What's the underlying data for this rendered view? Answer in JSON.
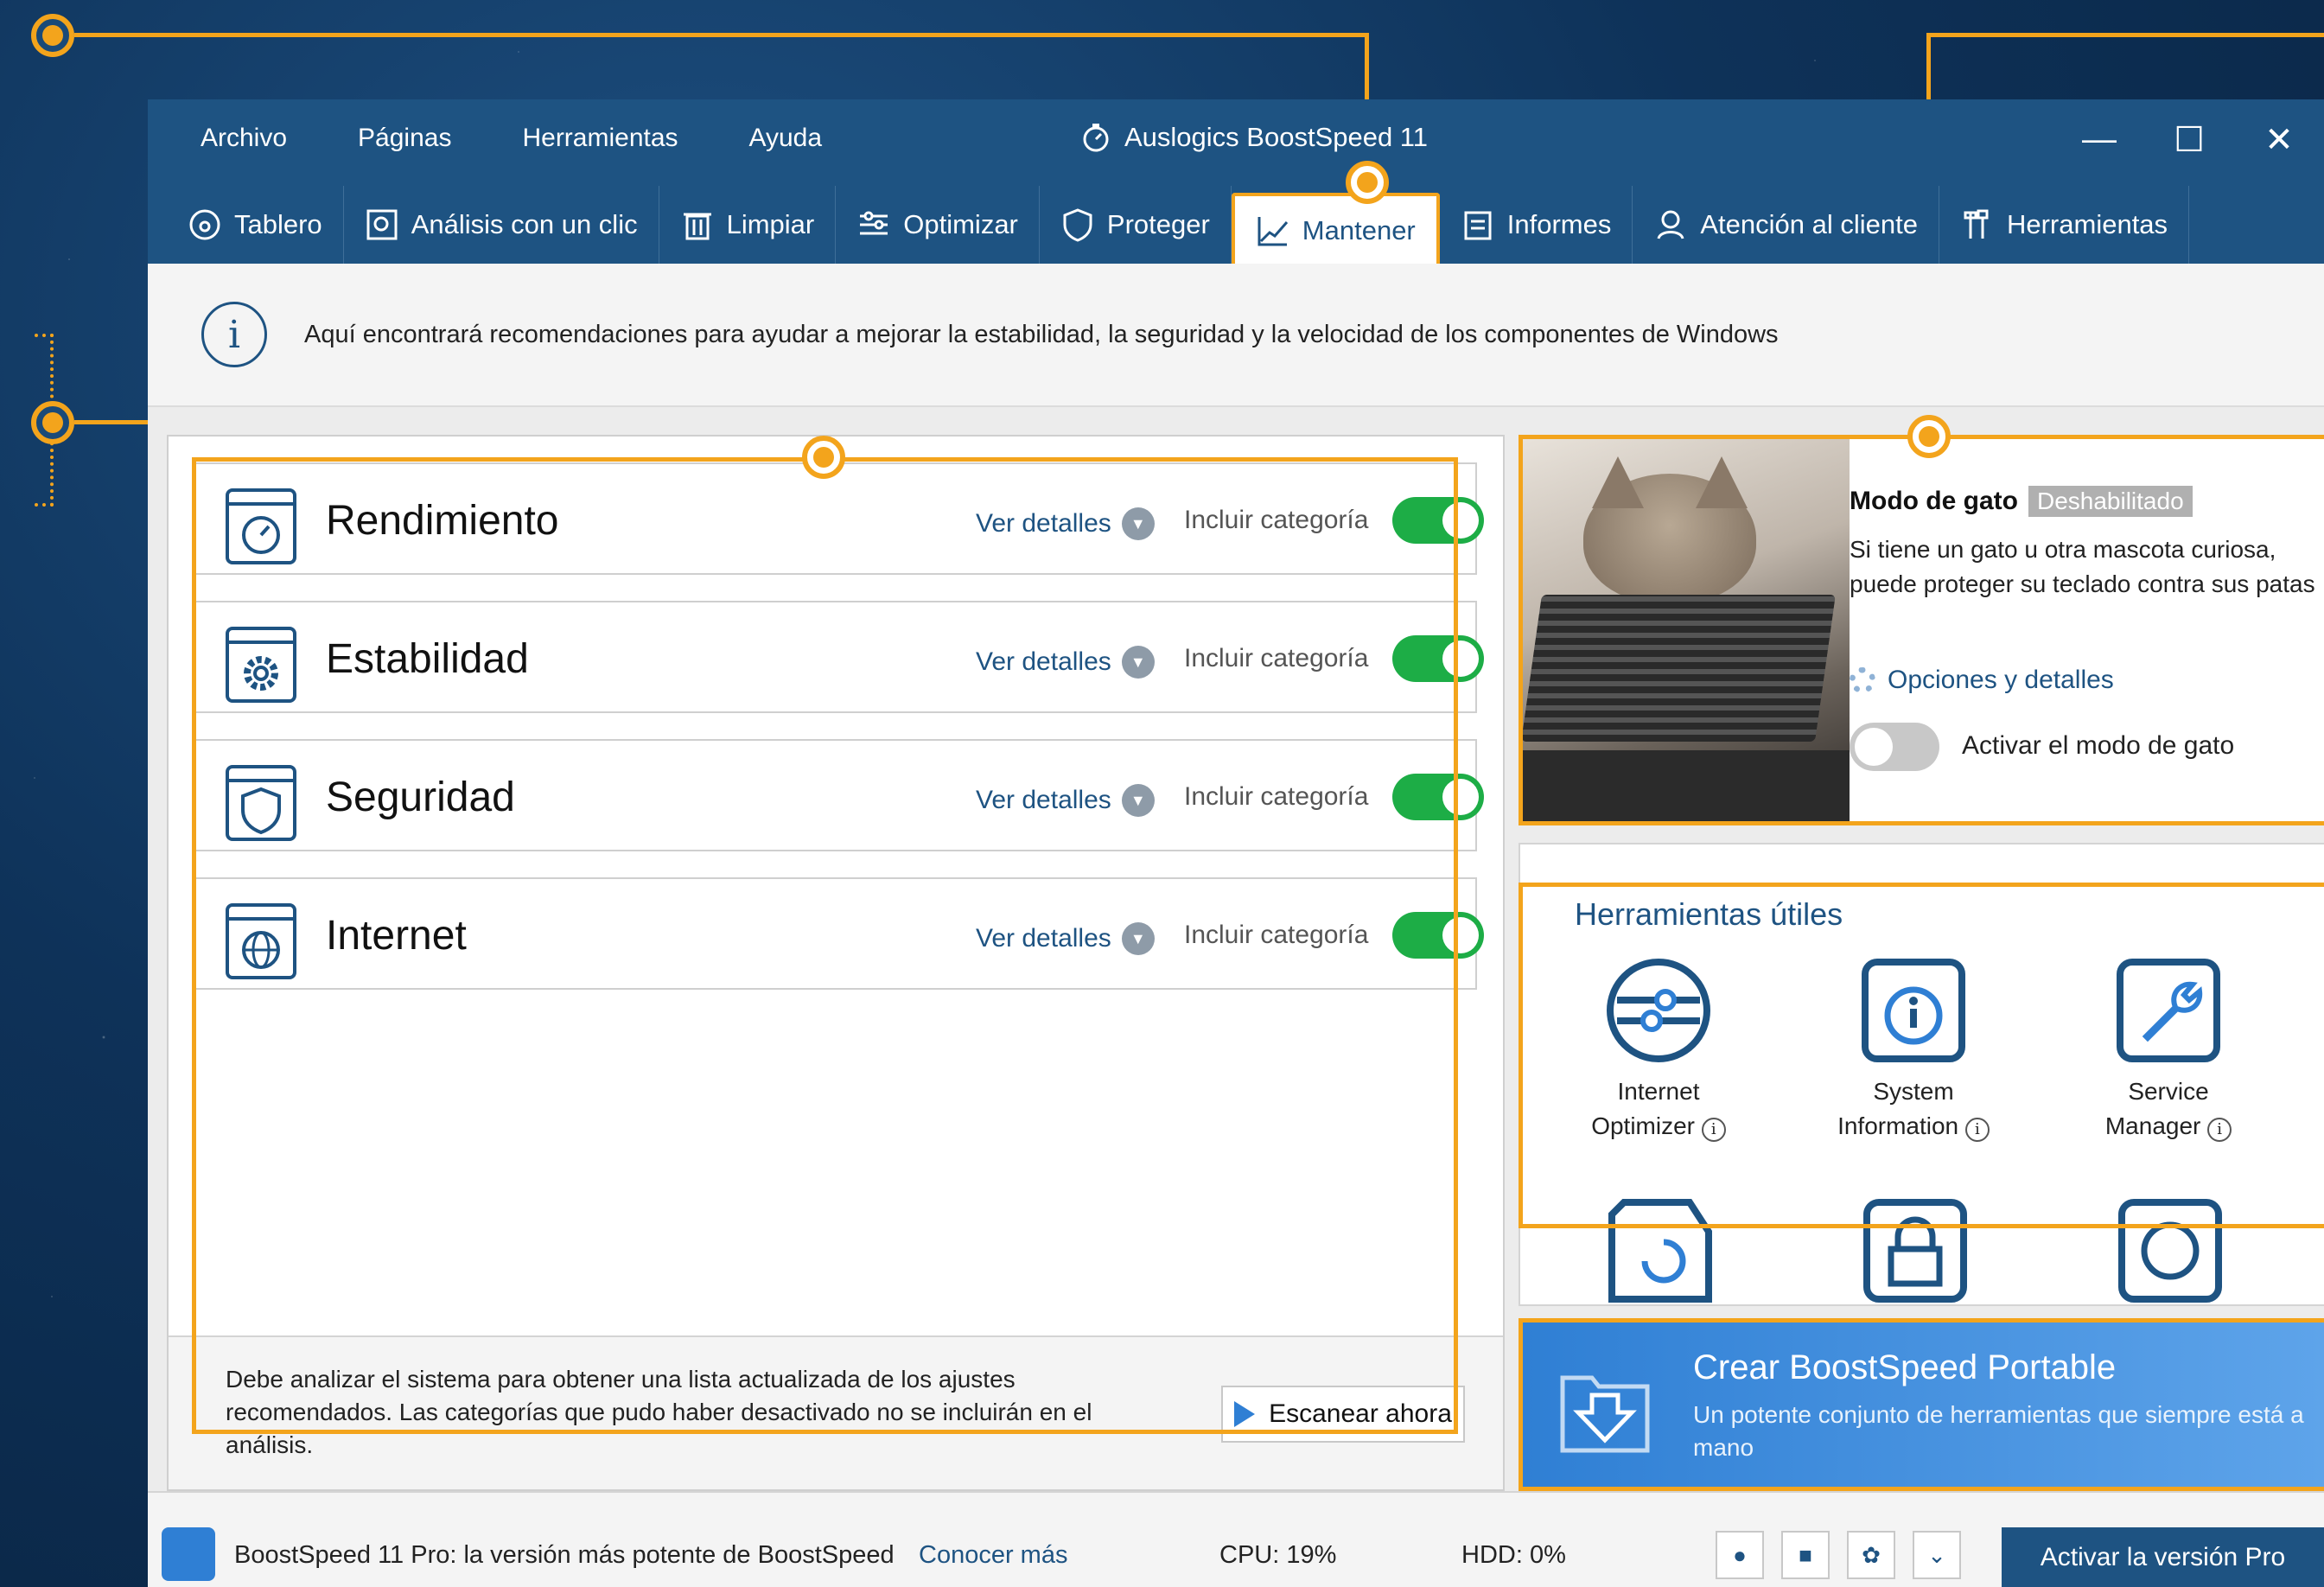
{
  "menu": [
    "Archivo",
    "Páginas",
    "Herramientas",
    "Ayuda"
  ],
  "app_title": "Auslogics BoostSpeed 11",
  "window_controls": {
    "minimize": "—",
    "maximize": "☐",
    "close": "✕"
  },
  "tabs": [
    {
      "label": "Tablero",
      "icon": "dashboard-icon"
    },
    {
      "label": "Análisis con un clic",
      "icon": "scan-icon"
    },
    {
      "label": "Limpiar",
      "icon": "trash-icon"
    },
    {
      "label": "Optimizar",
      "icon": "sliders-icon"
    },
    {
      "label": "Proteger",
      "icon": "shield-icon"
    },
    {
      "label": "Mantener",
      "icon": "chart-icon",
      "active": true
    },
    {
      "label": "Informes",
      "icon": "report-icon"
    },
    {
      "label": "Atención al cliente",
      "icon": "user-icon"
    },
    {
      "label": "Herramientas",
      "icon": "tools-icon"
    }
  ],
  "info": {
    "icon_glyph": "i",
    "text": "Aquí encontrará recomendaciones para ayudar a mejorar la estabilidad, la seguridad y la velocidad de los componentes de Windows"
  },
  "categories": [
    {
      "name": "Rendimiento",
      "icon": "stopwatch-icon",
      "details": "Ver detalles",
      "include": "Incluir categoría",
      "enabled": true
    },
    {
      "name": "Estabilidad",
      "icon": "gear-icon",
      "details": "Ver detalles",
      "include": "Incluir categoría",
      "enabled": true
    },
    {
      "name": "Seguridad",
      "icon": "shield-icon",
      "details": "Ver detalles",
      "include": "Incluir categoría",
      "enabled": true
    },
    {
      "name": "Internet",
      "icon": "globe-icon",
      "details": "Ver detalles",
      "include": "Incluir categoría",
      "enabled": true
    }
  ],
  "scan": {
    "text": "Debe analizar el sistema para obtener una lista actualizada de los ajustes recomendados. Las categorías que pudo haber desactivado no se incluirán en el análisis.",
    "button": "Escanear ahora"
  },
  "cat_mode": {
    "title": "Modo de gato",
    "status": "Deshabilitado",
    "description": "Si tiene un gato u otra mascota curiosa, puede proteger su teclado contra sus patas",
    "options_link": "Opciones y detalles",
    "toggle_label": "Activar el modo de gato",
    "enabled": false
  },
  "tools": {
    "title": "Herramientas útiles",
    "items": [
      {
        "line1": "Internet",
        "line2": "Optimizer",
        "icon": "internet-optimizer-icon"
      },
      {
        "line1": "System",
        "line2": "Information",
        "icon": "system-information-icon"
      },
      {
        "line1": "Service",
        "line2": "Manager",
        "icon": "service-manager-icon"
      }
    ],
    "help_glyph": "i"
  },
  "portable": {
    "title": "Crear BoostSpeed Portable",
    "subtitle": "Un potente conjunto de herramientas que siempre está a mano"
  },
  "status": {
    "pro_text": "BoostSpeed 11 Pro: la versión más potente de BoostSpeed",
    "more_link": "Conocer más",
    "cpu": "CPU: 19%",
    "hdd": "HDD: 0%",
    "activate": "Activar la versión Pro"
  },
  "colors": {
    "accent": "#f3a41c",
    "brand": "#1e5382",
    "toggle_on": "#1dad46"
  }
}
